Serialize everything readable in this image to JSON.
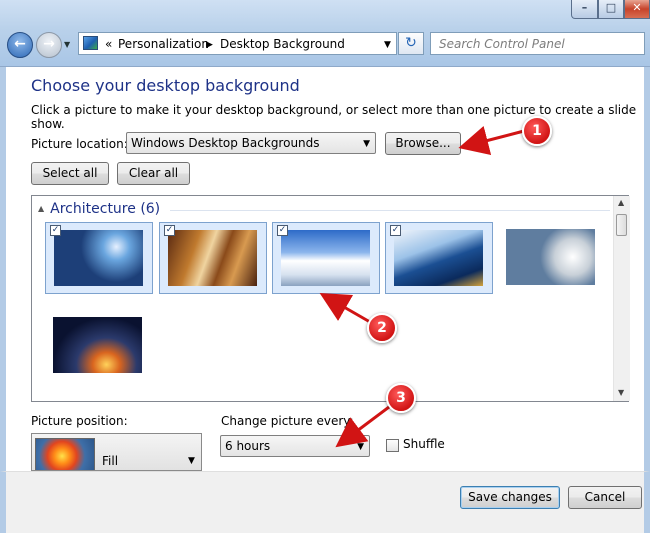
{
  "window": {
    "breadcrumb": [
      "«",
      "Personalization",
      "Desktop Background"
    ],
    "search_placeholder": "Search Control Panel"
  },
  "page": {
    "heading": "Choose your desktop background",
    "subtext": "Click a picture to make it your desktop background, or select more than one picture to create a slide show."
  },
  "location": {
    "label": "Picture location:",
    "value": "Windows Desktop Backgrounds",
    "browse_label": "Browse..."
  },
  "buttons": {
    "select_all": "Select all",
    "clear_all": "Clear all",
    "save": "Save changes",
    "cancel": "Cancel"
  },
  "gallery": {
    "group_title": "Architecture (6)",
    "tiles": [
      {
        "checked": true
      },
      {
        "checked": true
      },
      {
        "checked": true
      },
      {
        "checked": true
      },
      {
        "checked": false
      },
      {
        "checked": false
      }
    ]
  },
  "position": {
    "label": "Picture position:",
    "value": "Fill"
  },
  "interval": {
    "label": "Change picture every:",
    "value": "6 hours",
    "shuffle_label": "Shuffle",
    "shuffle_checked": false
  },
  "annotations": [
    "1",
    "2",
    "3"
  ],
  "colors": {
    "heading": "#1e3287",
    "annotation": "#d11414",
    "selection": "#dceafc"
  }
}
